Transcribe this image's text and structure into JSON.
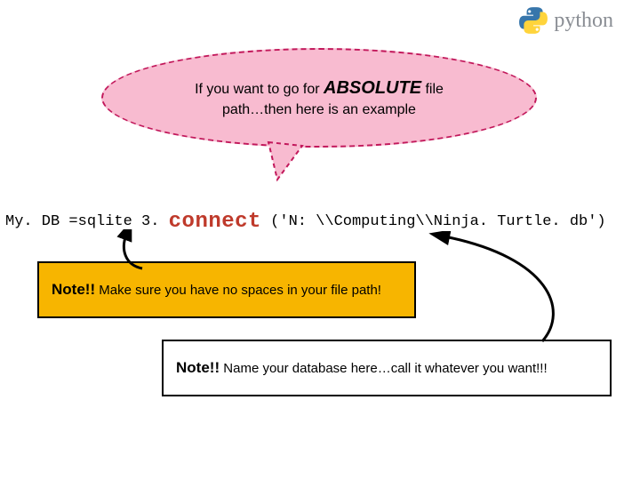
{
  "logo": {
    "text": "python"
  },
  "bubble": {
    "pre": "If you want to go for ",
    "emph": "ABSOLUTE",
    "post_top": " file",
    "line2": "path…then here is an example"
  },
  "code": {
    "lhs": "My. DB =sqlite 3",
    "dot": ". ",
    "connect": "connect",
    "args": " ('N: \\\\Computing\\\\Ninja. Turtle. db')"
  },
  "note1": {
    "strong": "Note!!",
    "rest": " Make sure you have no spaces in your file path!"
  },
  "note2": {
    "strong": "Note!!",
    "rest": " Name your database here…call it whatever you want!!!"
  }
}
